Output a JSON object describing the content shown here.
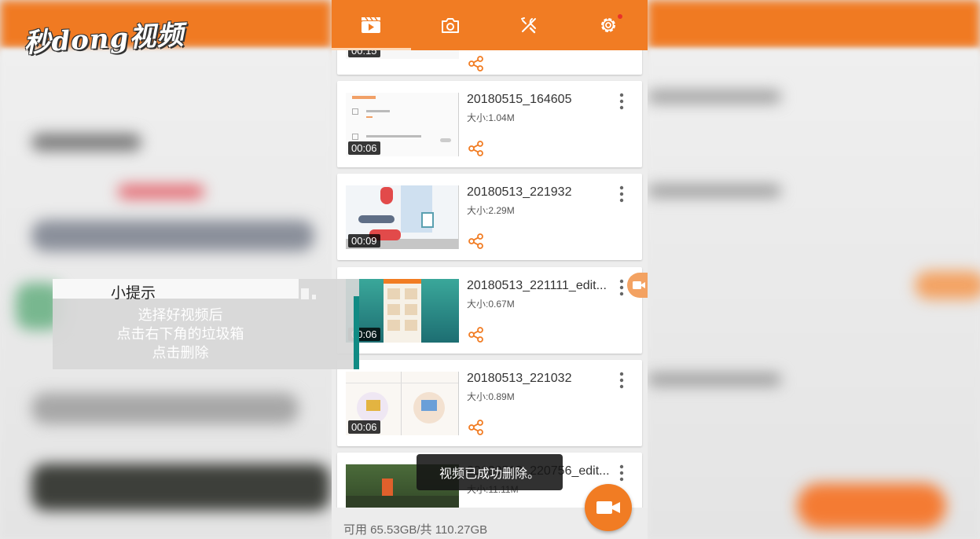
{
  "watermark": {
    "logo_text": "秒dong视频"
  },
  "tip": {
    "title": "小提示",
    "lines": [
      "选择好视频后",
      "点击右下角的垃圾箱",
      "点击删除"
    ]
  },
  "top_tabs": [
    {
      "icon": "video-icon"
    },
    {
      "icon": "camera-icon"
    },
    {
      "icon": "tools-icon"
    },
    {
      "icon": "settings-icon"
    }
  ],
  "top_card": {
    "duration": "00:15"
  },
  "videos": [
    {
      "name": "20180515_164605",
      "size": "大小:1.04M",
      "duration": "00:06"
    },
    {
      "name": "20180513_221932",
      "size": "大小:2.29M",
      "duration": "00:09"
    },
    {
      "name": "20180513_221111_edit...",
      "size": "大小:0.67M",
      "duration": "00:06"
    },
    {
      "name": "20180513_221032",
      "size": "大小:0.89M",
      "duration": "00:06"
    },
    {
      "name": "20180513_220756_edit...",
      "size": "大小:11.11M",
      "duration": ""
    }
  ],
  "toast": "视频已成功删除。",
  "storage": "可用 65.53GB/共 110.27GB",
  "colors": {
    "accent": "#f17c23",
    "teal": "#118b84"
  }
}
